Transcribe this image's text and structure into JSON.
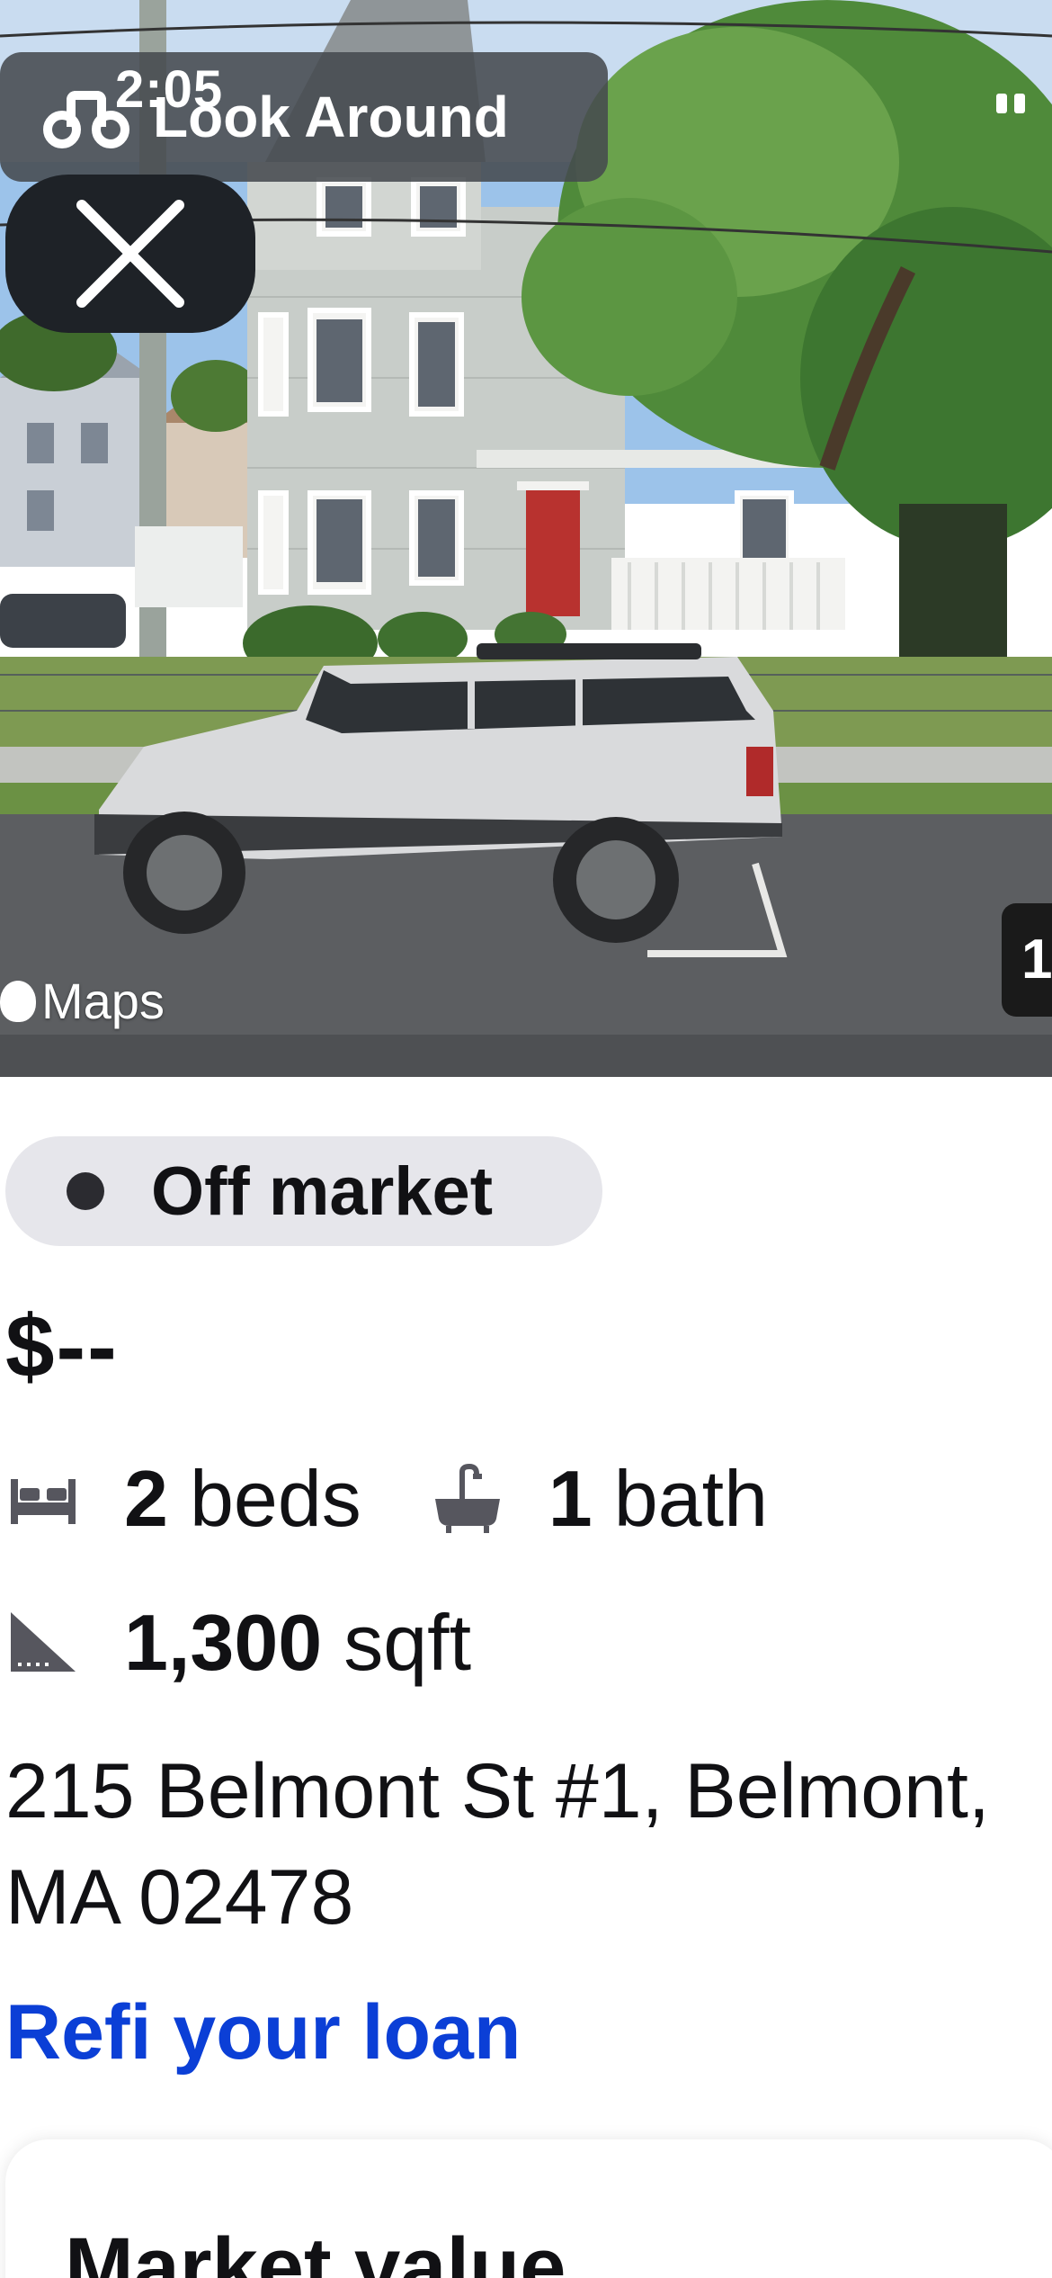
{
  "status_bar": {
    "time": "2:05"
  },
  "look_around": {
    "label": "Look Around",
    "icon": "binoculars-icon"
  },
  "close_button": {
    "icon": "close-icon"
  },
  "map_attribution": {
    "label": "Maps"
  },
  "carousel": {
    "page_indicator": "1"
  },
  "listing": {
    "status": "Off market",
    "price": "$--",
    "beds_value": "2",
    "beds_label": "beds",
    "baths_value": "1",
    "baths_label": "bath",
    "sqft_value": "1,300",
    "sqft_label": "sqft",
    "address_line1": "215 Belmont St #1, Belmont,",
    "address_line2": "MA 02478",
    "refi_link": "Refi your loan"
  },
  "market_value_card": {
    "title": "Market value"
  },
  "colors": {
    "link_blue": "#0b3fd6",
    "chip_bg": "#e6e6eb",
    "text_dark": "#111114"
  }
}
